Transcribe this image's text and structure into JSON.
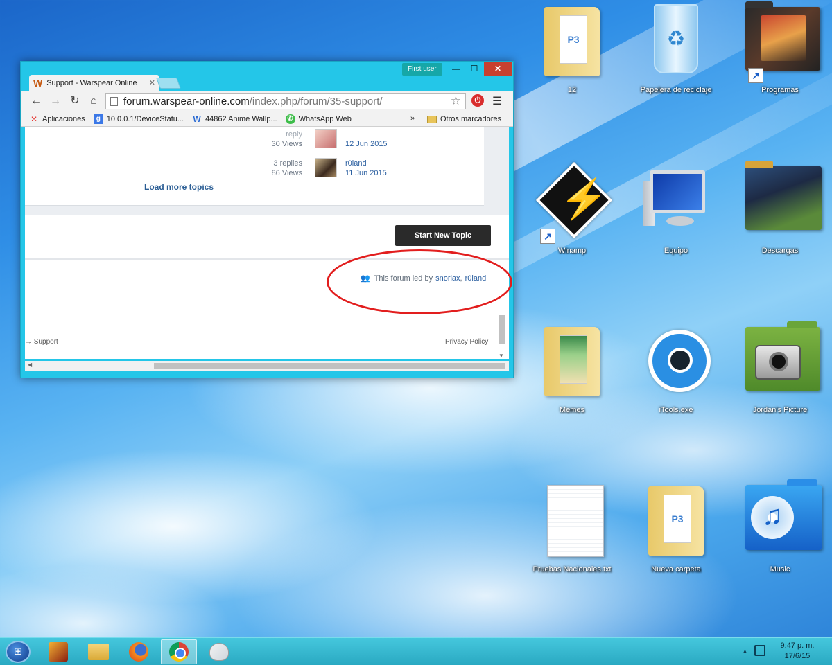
{
  "browser": {
    "user_badge": "First user",
    "tab": {
      "favicon": "W",
      "title": "Support - Warspear Online"
    },
    "url": {
      "host": "forum.warspear-online.com",
      "path": "/index.php/forum/35-support/"
    },
    "bookmarks": [
      {
        "label": "Aplicaciones",
        "icon": "apps-icon"
      },
      {
        "label": "10.0.0.1/DeviceStatu...",
        "icon": "google-icon"
      },
      {
        "label": "44862 Anime Wallp...",
        "icon": "w-icon"
      },
      {
        "label": "WhatsApp Web",
        "icon": "whatsapp-icon"
      }
    ],
    "bookmarks_more": "»",
    "other_bookmarks": "Otros marcadores"
  },
  "forum": {
    "topics": [
      {
        "replies": "reply",
        "views": "30 Views",
        "date": "12 Jun 2015"
      },
      {
        "replies": "3 replies",
        "views": "86 Views",
        "poster": "r0land",
        "date": "11 Jun 2015"
      }
    ],
    "load_more": "Load more topics",
    "start_topic": "Start New Topic",
    "led_by": "This forum led by",
    "leaders": "snorlax",
    "leaders_sep": ",",
    "leader2": "r0land",
    "footer_left": "→ Support",
    "footer_right": "Privacy Policy"
  },
  "desktop": {
    "icons": [
      {
        "label": "12"
      },
      {
        "label": "Papelera de reciclaje"
      },
      {
        "label": "Programas"
      },
      {
        "label": "Winamp"
      },
      {
        "label": "Equipo"
      },
      {
        "label": "Descargas"
      },
      {
        "label": "Memes"
      },
      {
        "label": "iTools.exe"
      },
      {
        "label": "Jordan's Picture"
      },
      {
        "label": "Pruebas Nacionales.txt"
      },
      {
        "label": "Nueva carpeta"
      },
      {
        "label": "Music"
      }
    ]
  },
  "taskbar": {
    "time": "9:47 p. m.",
    "date": "17/6/15"
  },
  "colors": {
    "window_frame": "#24c6e8",
    "close_button": "#c7402f",
    "annotation_ellipse": "#e21e1e",
    "start_topic_bg": "#2a2a2a",
    "link": "#2b5fa0"
  }
}
